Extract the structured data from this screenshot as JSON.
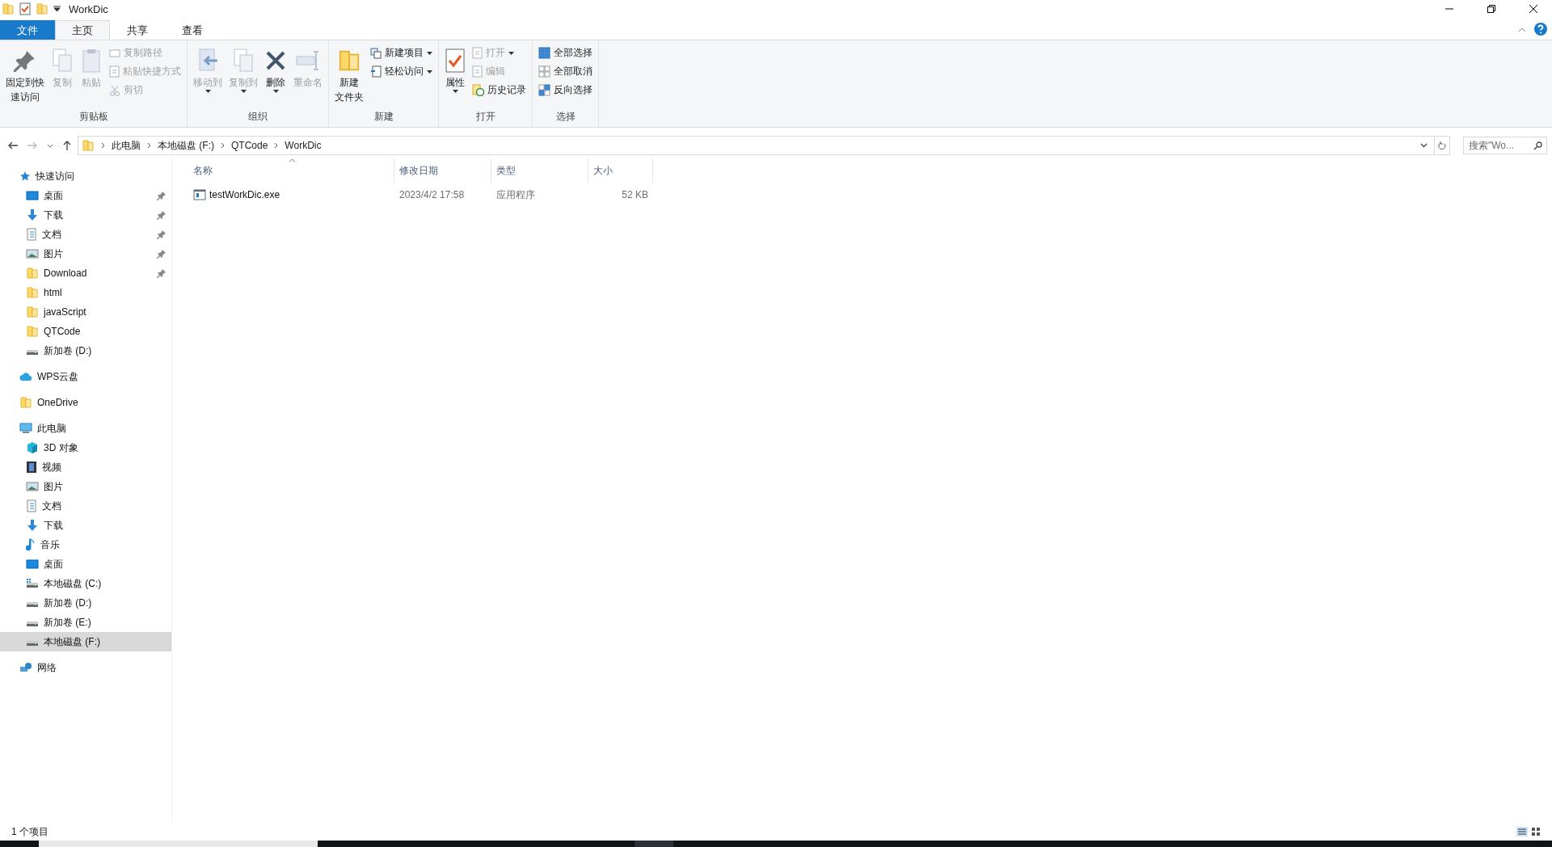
{
  "window": {
    "title": "WorkDic"
  },
  "ribbon_tabs": [
    {
      "label": "文件",
      "kind": "file",
      "selected": false
    },
    {
      "label": "主页",
      "kind": "tab",
      "selected": true
    },
    {
      "label": "共享",
      "kind": "tab",
      "selected": false
    },
    {
      "label": "查看",
      "kind": "tab",
      "selected": false
    }
  ],
  "ribbon_groups": [
    {
      "label": "剪贴板",
      "items": [
        {
          "kind": "large",
          "lines": [
            "固定到快",
            "速访问"
          ],
          "disabled": false,
          "dropdown": false
        },
        {
          "kind": "large",
          "lines": [
            "复制"
          ],
          "disabled": true,
          "dropdown": false
        },
        {
          "kind": "large",
          "lines": [
            "粘贴"
          ],
          "disabled": true,
          "dropdown": false
        },
        {
          "kind": "small",
          "label": "复制路径",
          "disabled": true,
          "dropdown": false
        },
        {
          "kind": "small",
          "label": "粘贴快捷方式",
          "disabled": true,
          "dropdown": false
        },
        {
          "kind": "small",
          "label": "剪切",
          "disabled": true,
          "dropdown": false
        }
      ]
    },
    {
      "label": "组织",
      "items": [
        {
          "kind": "large",
          "lines": [
            "移动到"
          ],
          "disabled": true,
          "dropdown": true
        },
        {
          "kind": "large",
          "lines": [
            "复制到"
          ],
          "disabled": true,
          "dropdown": true
        },
        {
          "kind": "large",
          "lines": [
            "删除"
          ],
          "disabled": false,
          "dropdown": true
        },
        {
          "kind": "large",
          "lines": [
            "重命名"
          ],
          "disabled": true,
          "dropdown": false
        }
      ]
    },
    {
      "label": "新建",
      "items": [
        {
          "kind": "large",
          "lines": [
            "新建",
            "文件夹"
          ],
          "disabled": false,
          "dropdown": false
        },
        {
          "kind": "small",
          "label": "新建项目",
          "disabled": false,
          "dropdown": true
        },
        {
          "kind": "small",
          "label": "轻松访问",
          "disabled": false,
          "dropdown": true
        }
      ]
    },
    {
      "label": "打开",
      "items": [
        {
          "kind": "large",
          "lines": [
            "属性"
          ],
          "disabled": false,
          "dropdown": true
        },
        {
          "kind": "small",
          "label": "打开",
          "disabled": true,
          "dropdown": true
        },
        {
          "kind": "small",
          "label": "编辑",
          "disabled": true,
          "dropdown": false
        },
        {
          "kind": "small",
          "label": "历史记录",
          "disabled": false,
          "dropdown": false
        }
      ]
    },
    {
      "label": "选择",
      "items": [
        {
          "kind": "small",
          "label": "全部选择",
          "disabled": false,
          "dropdown": false
        },
        {
          "kind": "small",
          "label": "全部取消",
          "disabled": false,
          "dropdown": false
        },
        {
          "kind": "small",
          "label": "反向选择",
          "disabled": false,
          "dropdown": false
        }
      ]
    }
  ],
  "address": {
    "path": [
      "此电脑",
      "本地磁盘 (F:)",
      "QTCode",
      "WorkDic"
    ]
  },
  "search": {
    "placeholder": "搜索\"Wo..."
  },
  "sidebar": [
    {
      "label": "快速访问",
      "kind": "star",
      "children": [
        {
          "label": "桌面",
          "kind": "desktop",
          "pinned": true,
          "selected": false
        },
        {
          "label": "下载",
          "kind": "download",
          "pinned": true,
          "selected": false
        },
        {
          "label": "文档",
          "kind": "document",
          "pinned": true,
          "selected": false
        },
        {
          "label": "图片",
          "kind": "picture",
          "pinned": true,
          "selected": false
        },
        {
          "label": "Download",
          "kind": "folder",
          "pinned": true,
          "selected": false
        },
        {
          "label": "html",
          "kind": "folder",
          "pinned": false,
          "selected": false
        },
        {
          "label": "javaScript",
          "kind": "folder",
          "pinned": false,
          "selected": false
        },
        {
          "label": "QTCode",
          "kind": "folder",
          "pinned": false,
          "selected": false
        },
        {
          "label": "新加卷 (D:)",
          "kind": "drive",
          "pinned": false,
          "selected": false
        }
      ]
    },
    {
      "label": "WPS云盘",
      "kind": "cloud"
    },
    {
      "label": "OneDrive",
      "kind": "folder"
    },
    {
      "label": "此电脑",
      "kind": "pc",
      "children": [
        {
          "label": "3D 对象",
          "kind": "cube",
          "selected": false
        },
        {
          "label": "视频",
          "kind": "video",
          "selected": false
        },
        {
          "label": "图片",
          "kind": "picture",
          "selected": false
        },
        {
          "label": "文档",
          "kind": "document",
          "selected": false
        },
        {
          "label": "下载",
          "kind": "download",
          "selected": false
        },
        {
          "label": "音乐",
          "kind": "music",
          "selected": false
        },
        {
          "label": "桌面",
          "kind": "desktop",
          "selected": false
        },
        {
          "label": "本地磁盘 (C:)",
          "kind": "sysdrive",
          "selected": false
        },
        {
          "label": "新加卷 (D:)",
          "kind": "drive",
          "selected": false
        },
        {
          "label": "新加卷 (E:)",
          "kind": "drive",
          "selected": false
        },
        {
          "label": "本地磁盘 (F:)",
          "kind": "drive",
          "selected": true
        }
      ]
    },
    {
      "label": "网络",
      "kind": "network"
    }
  ],
  "table": {
    "columns": [
      {
        "label": "名称",
        "sorted": true
      },
      {
        "label": "修改日期",
        "sorted": false
      },
      {
        "label": "类型",
        "sorted": false
      },
      {
        "label": "大小",
        "sorted": false
      }
    ],
    "rows": [
      {
        "name": "testWorkDic.exe",
        "date": "2023/4/2 17:58",
        "type": "应用程序",
        "size": "52 KB"
      }
    ]
  },
  "status_bar": {
    "count": "1 个项目"
  }
}
